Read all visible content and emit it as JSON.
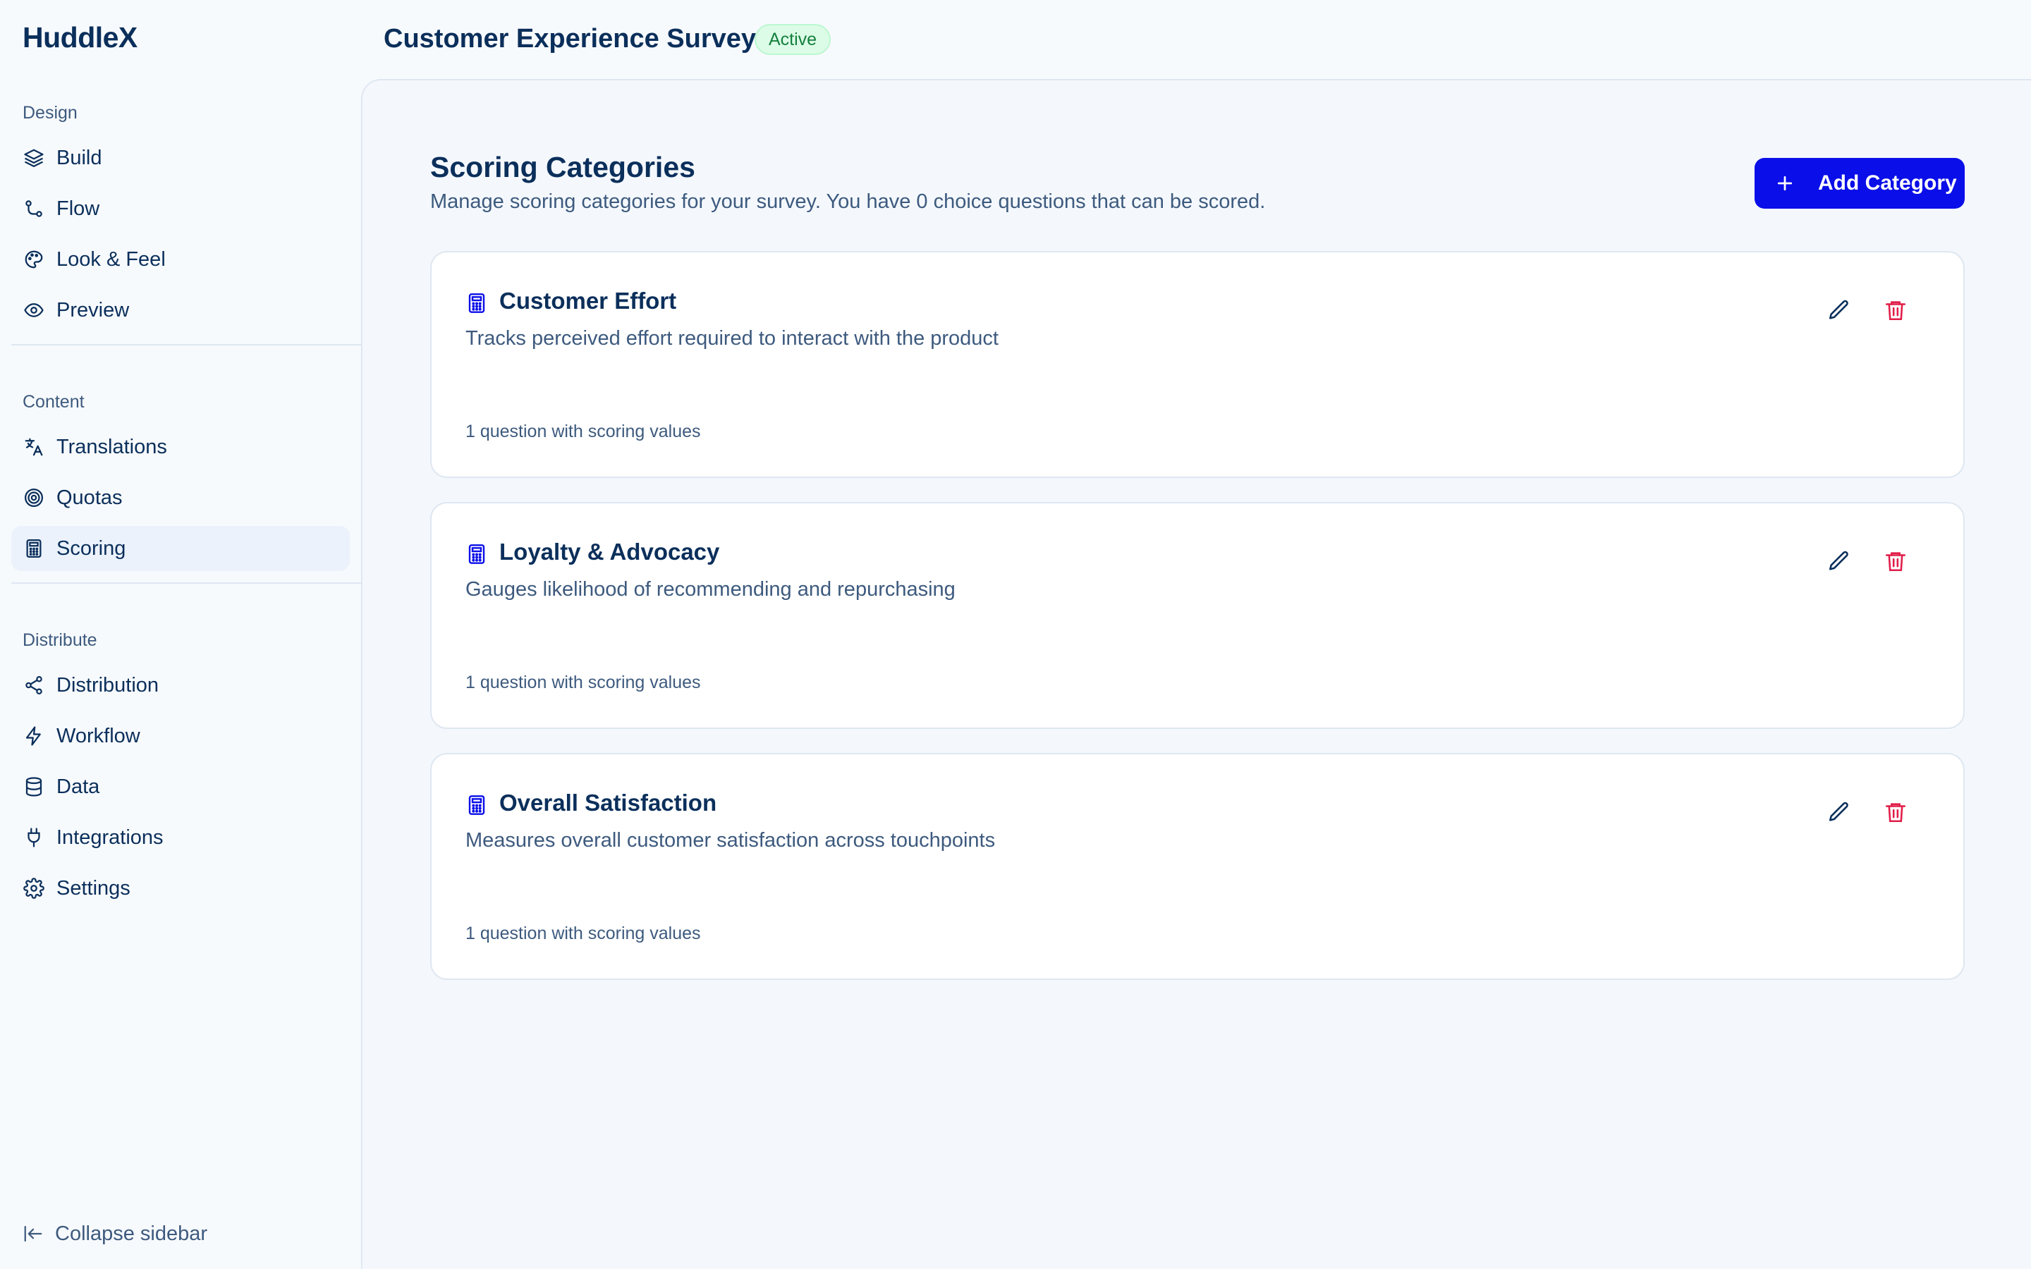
{
  "brand": "HuddleX",
  "sidebar": {
    "sections": [
      {
        "label": "Design",
        "items": [
          {
            "label": "Build",
            "icon": "layers-icon"
          },
          {
            "label": "Flow",
            "icon": "route-icon"
          },
          {
            "label": "Look & Feel",
            "icon": "palette-icon"
          },
          {
            "label": "Preview",
            "icon": "eye-icon"
          }
        ]
      },
      {
        "label": "Content",
        "items": [
          {
            "label": "Translations",
            "icon": "translate-icon"
          },
          {
            "label": "Quotas",
            "icon": "target-icon"
          },
          {
            "label": "Scoring",
            "icon": "calculator-icon",
            "active": true
          }
        ]
      },
      {
        "label": "Distribute",
        "items": [
          {
            "label": "Distribution",
            "icon": "share-icon"
          },
          {
            "label": "Workflow",
            "icon": "lightning-icon"
          },
          {
            "label": "Data",
            "icon": "database-icon"
          },
          {
            "label": "Integrations",
            "icon": "plug-icon"
          },
          {
            "label": "Settings",
            "icon": "gear-icon"
          }
        ]
      }
    ],
    "collapse_label": "Collapse sidebar"
  },
  "header": {
    "survey_title": "Customer Experience Survey",
    "status": "Active"
  },
  "main": {
    "title": "Scoring Categories",
    "subtitle": "Manage scoring categories for your survey. You have 0 choice questions that can be scored.",
    "add_button_label": "Add Category",
    "categories": [
      {
        "name": "Customer Effort",
        "description": "Tracks perceived effort required to interact with the product",
        "meta": "1 question with scoring values"
      },
      {
        "name": "Loyalty & Advocacy",
        "description": "Gauges likelihood of recommending and repurchasing",
        "meta": "1 question with scoring values"
      },
      {
        "name": "Overall Satisfaction",
        "description": "Measures overall customer satisfaction across touchpoints",
        "meta": "1 question with scoring values"
      }
    ]
  },
  "colors": {
    "primary": "#0a0ee8",
    "text": "#0b2f5b",
    "muted": "#3d5a7e",
    "danger": "#e11d48",
    "active_bg": "#ebf2fb",
    "success": "#15803d"
  }
}
